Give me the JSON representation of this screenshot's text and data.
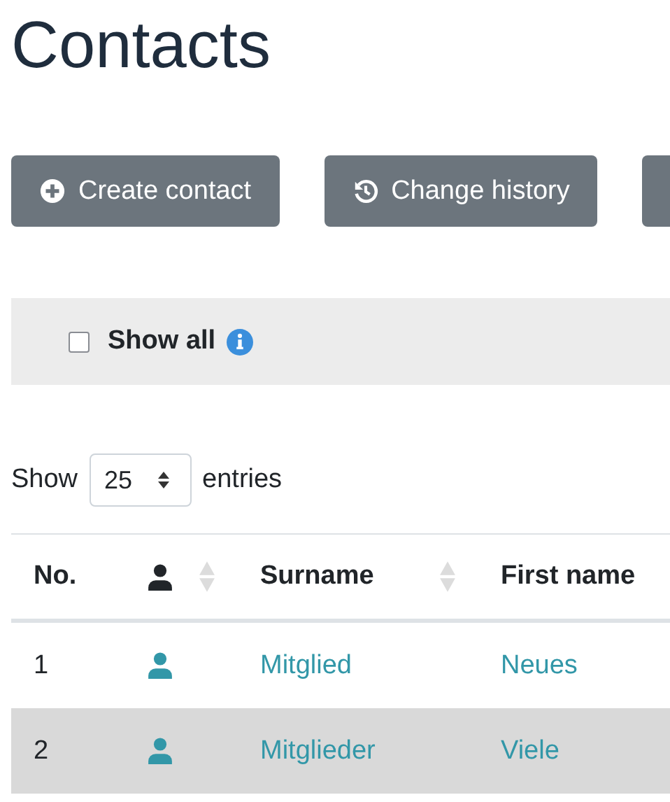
{
  "title": "Contacts",
  "buttons": [
    {
      "label": "Create contact",
      "kind": "add"
    },
    {
      "label": "Change history",
      "kind": "history"
    }
  ],
  "filter": {
    "label": "Show all",
    "checked": false
  },
  "length": {
    "prefix": "Show",
    "value": "25",
    "suffix": "entries"
  },
  "table": {
    "columns": [
      {
        "label": "No.",
        "kind": "text",
        "sortable": false
      },
      {
        "kind": "person",
        "sortable": true
      },
      {
        "label": "Surname",
        "kind": "text",
        "sortable": true
      },
      {
        "label": "First name",
        "kind": "text",
        "sortable": false
      }
    ],
    "rows": [
      {
        "no": "1",
        "surname": "Mitglied",
        "first_name": "Neues",
        "selected": false
      },
      {
        "no": "2",
        "surname": "Mitglieder",
        "first_name": "Viele",
        "selected": true
      }
    ]
  }
}
